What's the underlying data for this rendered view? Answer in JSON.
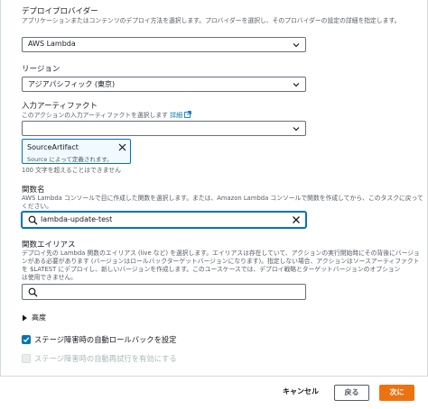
{
  "deploy_provider": {
    "label": "デプロイプロバイダー",
    "description": "アプリケーションまたはコンテンツのデプロイ方法を選択します。プロバイダーを選択し、そのプロバイダーの設定の詳細を指定します。",
    "value": "AWS Lambda"
  },
  "region": {
    "label": "リージョン",
    "value": "アジアパシフィック (東京)"
  },
  "input_artifacts": {
    "label": "入力アーティファクト",
    "description": "このアクションの入力アーティファクトを選択します",
    "link_text": "詳細",
    "value": "",
    "token_title": "SourceArtifact",
    "token_subtitle": "Source によって定義されます。",
    "hint": "100 文字を超えることはできません"
  },
  "function_name": {
    "label": "関数名",
    "description_line1": "AWS Lambda コンソールで目に作成した関数を選択します。または、Amazon Lambda コンソールで関数を作成してから、このタスクに戻って",
    "description_line2": "ください。",
    "value": "lambda-update-test"
  },
  "function_alias": {
    "label": "関数エイリアス",
    "description_line1": "デプロイ先の Lambda 関数のエイリアス (live など) を選択します。エイリアスは存在していて、アクションの実行開始時にその背後にバージョ",
    "description_line2": "ンがある必要があります (バージョンはロールバックターゲットバージョンになります)。指定しない場合、アクションはソースアーティファクト",
    "description_line3": "を $LATEST にデプロイし、新しいバージョンを作成します。このユースケースでは、デプロイ戦略とターゲットバージョンのオプション",
    "description_line4": "は使用できません。",
    "value": ""
  },
  "advanced": {
    "label": "高度"
  },
  "rollback": {
    "label": "ステージ障害時の自動ロールバックを設定",
    "checked": true
  },
  "retry": {
    "label": "ステージ障害時の自動再試行を有効にする",
    "checked": false
  },
  "footer": {
    "cancel_label": "キャンセル",
    "back_label": "戻る",
    "next_label": "次に"
  },
  "colors": {
    "accent": "#0073bb",
    "primary_button": "#ec7211"
  },
  "icons": {
    "chevron": "chevron-down-icon",
    "search": "search-icon",
    "clear": "close-icon",
    "external": "external-link-icon",
    "caret": "caret-right-icon",
    "check": "check-icon"
  }
}
